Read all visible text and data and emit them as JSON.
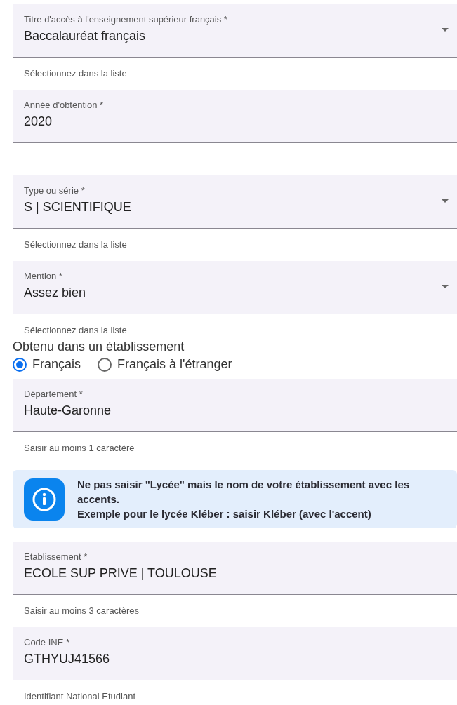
{
  "items": [
    {
      "kind": "field",
      "label": "Titre d'accès à l'enseignement supérieur français *",
      "value": "Baccalauréat français",
      "dropdown": true,
      "hint": "Sélectionnez dans la liste"
    },
    {
      "kind": "field",
      "label": "Année d'obtention *",
      "value": "2020",
      "dropdown": false
    },
    {
      "kind": "field",
      "label": "Type ou série *",
      "value": "S | SCIENTIFIQUE",
      "dropdown": true,
      "hint": "Sélectionnez dans la liste"
    },
    {
      "kind": "field",
      "label": "Mention *",
      "value": "Assez bien",
      "dropdown": true,
      "hint": "Sélectionnez dans la liste"
    },
    {
      "kind": "radio-group",
      "label": "Obtenu dans un établissement",
      "options": [
        {
          "label": "Français",
          "selected": true
        },
        {
          "label": "Français à l'étranger",
          "selected": false
        }
      ]
    },
    {
      "kind": "field",
      "label": "Département *",
      "value": "Haute-Garonne",
      "dropdown": false,
      "hint": "Saisir au moins 1 caractère"
    },
    {
      "kind": "info",
      "lines": [
        "Ne pas saisir \"Lycée\" mais le nom de votre établissement avec les accents.",
        "Exemple pour le lycée Kléber : saisir Kléber (avec l'accent)"
      ]
    },
    {
      "kind": "field",
      "label": "Etablissement *",
      "value": "ECOLE SUP PRIVE | TOULOUSE",
      "dropdown": false,
      "hint": "Saisir au moins 3 caractères"
    },
    {
      "kind": "field",
      "label": "Code INE *",
      "value": "GTHYUJ41566",
      "dropdown": false,
      "hint": "Identifiant National Etudiant"
    }
  ]
}
